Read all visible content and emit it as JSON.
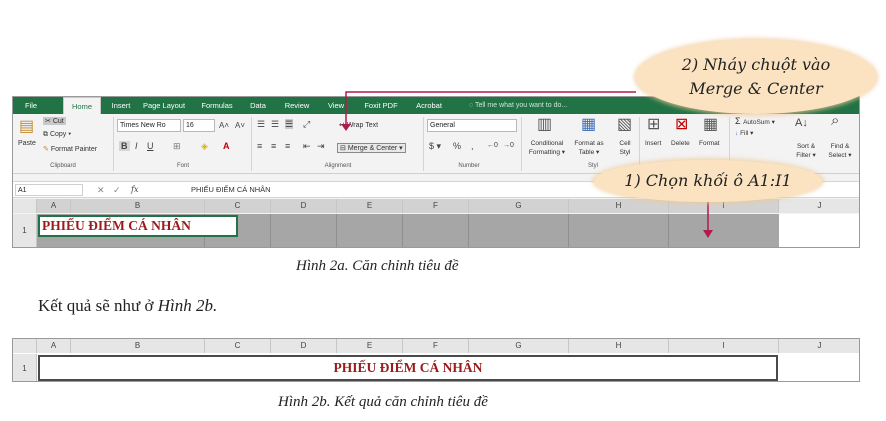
{
  "excel": {
    "tabs": [
      "File",
      "Home",
      "Insert",
      "Page Layout",
      "Formulas",
      "Data",
      "Review",
      "View",
      "Foxit PDF",
      "Acrobat"
    ],
    "active_tab": "Home",
    "tell_me": "Tell me what you want to do...",
    "clipboard": {
      "paste": "Paste",
      "cut": "Cut",
      "copy": "Copy",
      "format_painter": "Format Painter",
      "label": "Clipboard"
    },
    "font": {
      "name": "Times New Ro",
      "size": "16",
      "label": "Font"
    },
    "alignment": {
      "wrap_text": "Wrap Text",
      "merge_center": "Merge & Center",
      "label": "Alignment"
    },
    "number": {
      "format": "General",
      "label": "Number"
    },
    "styles": {
      "conditional": [
        "Conditional",
        "Formatting"
      ],
      "format_table": [
        "Format as",
        "Table"
      ],
      "cell_styles": [
        "Cell",
        "Styl"
      ],
      "label": "Styl"
    },
    "cells": {
      "insert": "Insert",
      "delete": "Delete",
      "format": "Format"
    },
    "editing": {
      "autosum": "AutoSum",
      "fill": "Fill",
      "sort_filter": [
        "Sort &",
        "Filter"
      ],
      "find_select": [
        "Find &",
        "Select"
      ]
    },
    "name_box": "A1",
    "fx": "fx",
    "formula": "PHIẾU ĐIỂM CÁ NHÂN",
    "columns": [
      "A",
      "B",
      "C",
      "D",
      "E",
      "F",
      "G",
      "H",
      "I",
      "J"
    ],
    "row_number": "1",
    "cell_text": "PHIẾU ĐIỂM CÁ NHÂN"
  },
  "callouts": {
    "merge_lines": [
      "2) Nháy chuột vào",
      "Merge & Center"
    ],
    "select": "1) Chọn khối ô A1:I1"
  },
  "captions": {
    "fig2a": "Hình 2a. Căn chỉnh tiêu đề",
    "result": "Kết quả sẽ như ở ",
    "result_ref": "Hình 2b.",
    "fig2b": "Hình 2b. Kết quả căn chỉnh tiêu đề"
  },
  "sheet2": {
    "columns": [
      "A",
      "B",
      "C",
      "D",
      "E",
      "F",
      "G",
      "H",
      "I",
      "J"
    ],
    "row_number": "1",
    "title": "PHIẾU ĐIỂM CÁ NHÂN"
  },
  "colors": {
    "excel_green": "#217346",
    "title_red": "#9b1b1b",
    "callout": "#fbe3c2",
    "arrow": "#b11a4a",
    "selection": "#a6a6a6"
  }
}
